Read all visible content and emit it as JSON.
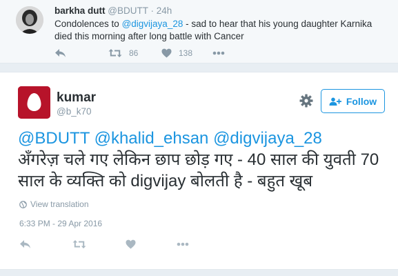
{
  "parent_tweet": {
    "author_name": "barkha dutt",
    "author_handle": "@BDUTT",
    "separator": "·",
    "time": "24h",
    "text_prefix": "Condolences to ",
    "mention": "@digvijaya_28",
    "text_suffix": " - sad to hear that his young daughter Karnika died this morning after long battle with Cancer",
    "retweet_count": "86",
    "like_count": "138"
  },
  "main_tweet": {
    "author_name": "kumar",
    "author_handle": "@b_k70",
    "follow_label": "Follow",
    "mention_line": "@BDUTT @khalid_ehsan @digvijaya_28",
    "text_line2": "अँगरेज़ चले गए लेकिन छाप छोड़ गए - 40 साल की युवती 70",
    "text_line3": "साल के व्यक्ति को digvijay बोलती है - बहुत खूब",
    "view_translation": "View translation",
    "timestamp": "6:33 PM - 29 Apr 2016"
  },
  "icons": {
    "reply": "reply-icon",
    "retweet": "retweet-icon",
    "like": "heart-icon",
    "more": "more-icon",
    "settings": "gear-icon",
    "follow": "follow-user-icon",
    "globe": "globe-icon",
    "default_avatar": "egg-avatar-icon"
  },
  "colors": {
    "link": "#1b95e0",
    "muted": "#8899a6",
    "text": "#292f33",
    "avatar_red": "#b7132a"
  }
}
